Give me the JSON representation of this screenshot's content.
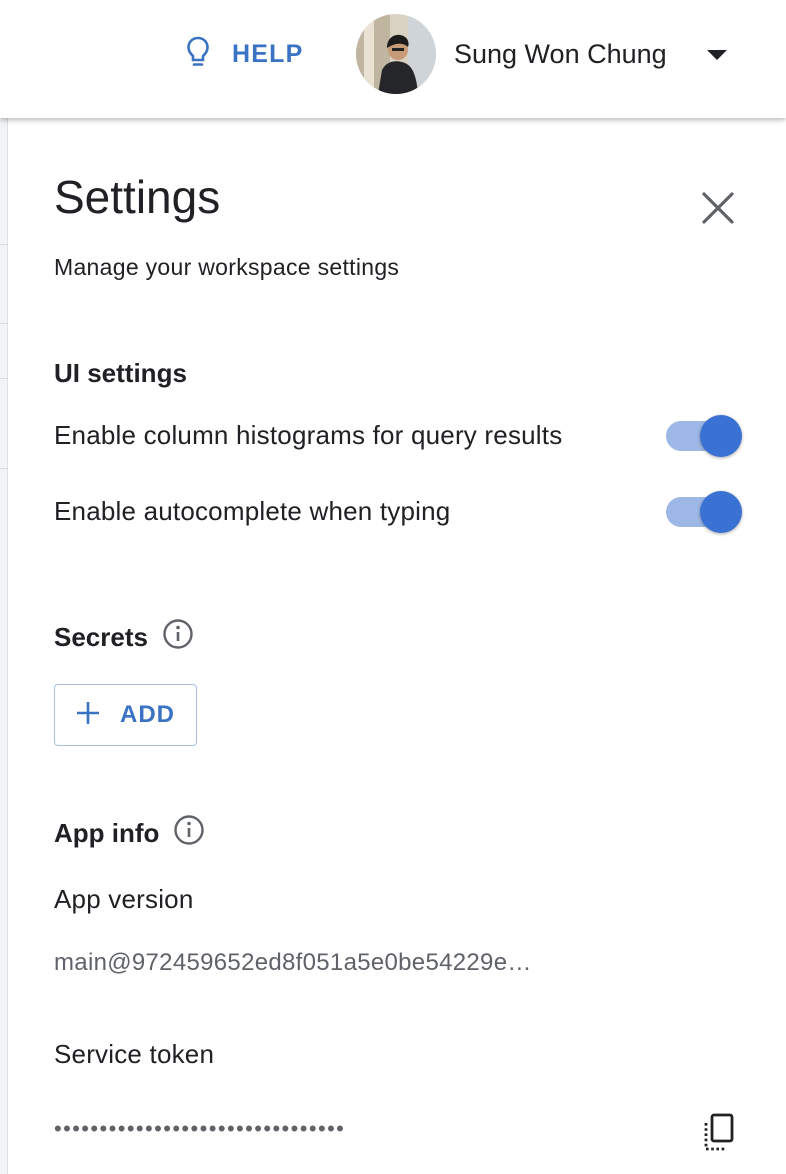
{
  "header": {
    "help_label": "HELP",
    "help_icon": "lightbulb-icon",
    "user_name": "Sung Won Chung",
    "user_menu_icon": "caret-down-icon"
  },
  "settings": {
    "title": "Settings",
    "subtitle": "Manage your workspace settings",
    "close_icon": "close-icon",
    "ui_section": {
      "heading": "UI settings",
      "toggles": [
        {
          "label": "Enable column histograms for query results",
          "enabled": true
        },
        {
          "label": "Enable autocomplete when typing",
          "enabled": true
        }
      ]
    },
    "secrets_section": {
      "heading": "Secrets",
      "info_icon": "info-icon",
      "add_label": "ADD",
      "add_icon": "plus-icon"
    },
    "app_info_section": {
      "heading": "App info",
      "info_icon": "info-icon",
      "version_label": "App version",
      "version_value": "main@972459652ed8f051a5e0be54229e…",
      "token_label": "Service token",
      "token_value": "••••••••••••••••••••••••••••••••",
      "copy_icon": "copy-icon"
    }
  },
  "colors": {
    "accent": "#3a72c4",
    "toggle_knob": "#3a72d4",
    "toggle_track": "#9db8e6"
  }
}
